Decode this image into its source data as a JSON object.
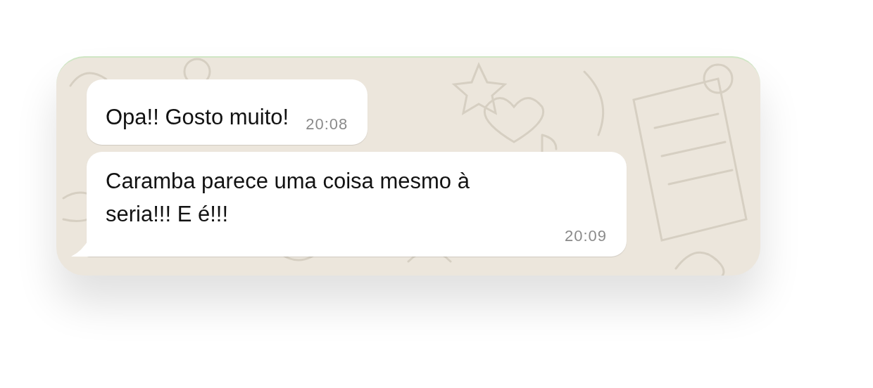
{
  "messages": [
    {
      "text": "Opa!! Gosto muito!",
      "time": "20:08",
      "tail": false
    },
    {
      "text": "Caramba parece uma coisa mesmo à seria!!! E é!!!",
      "time": "20:09",
      "tail": true
    }
  ]
}
